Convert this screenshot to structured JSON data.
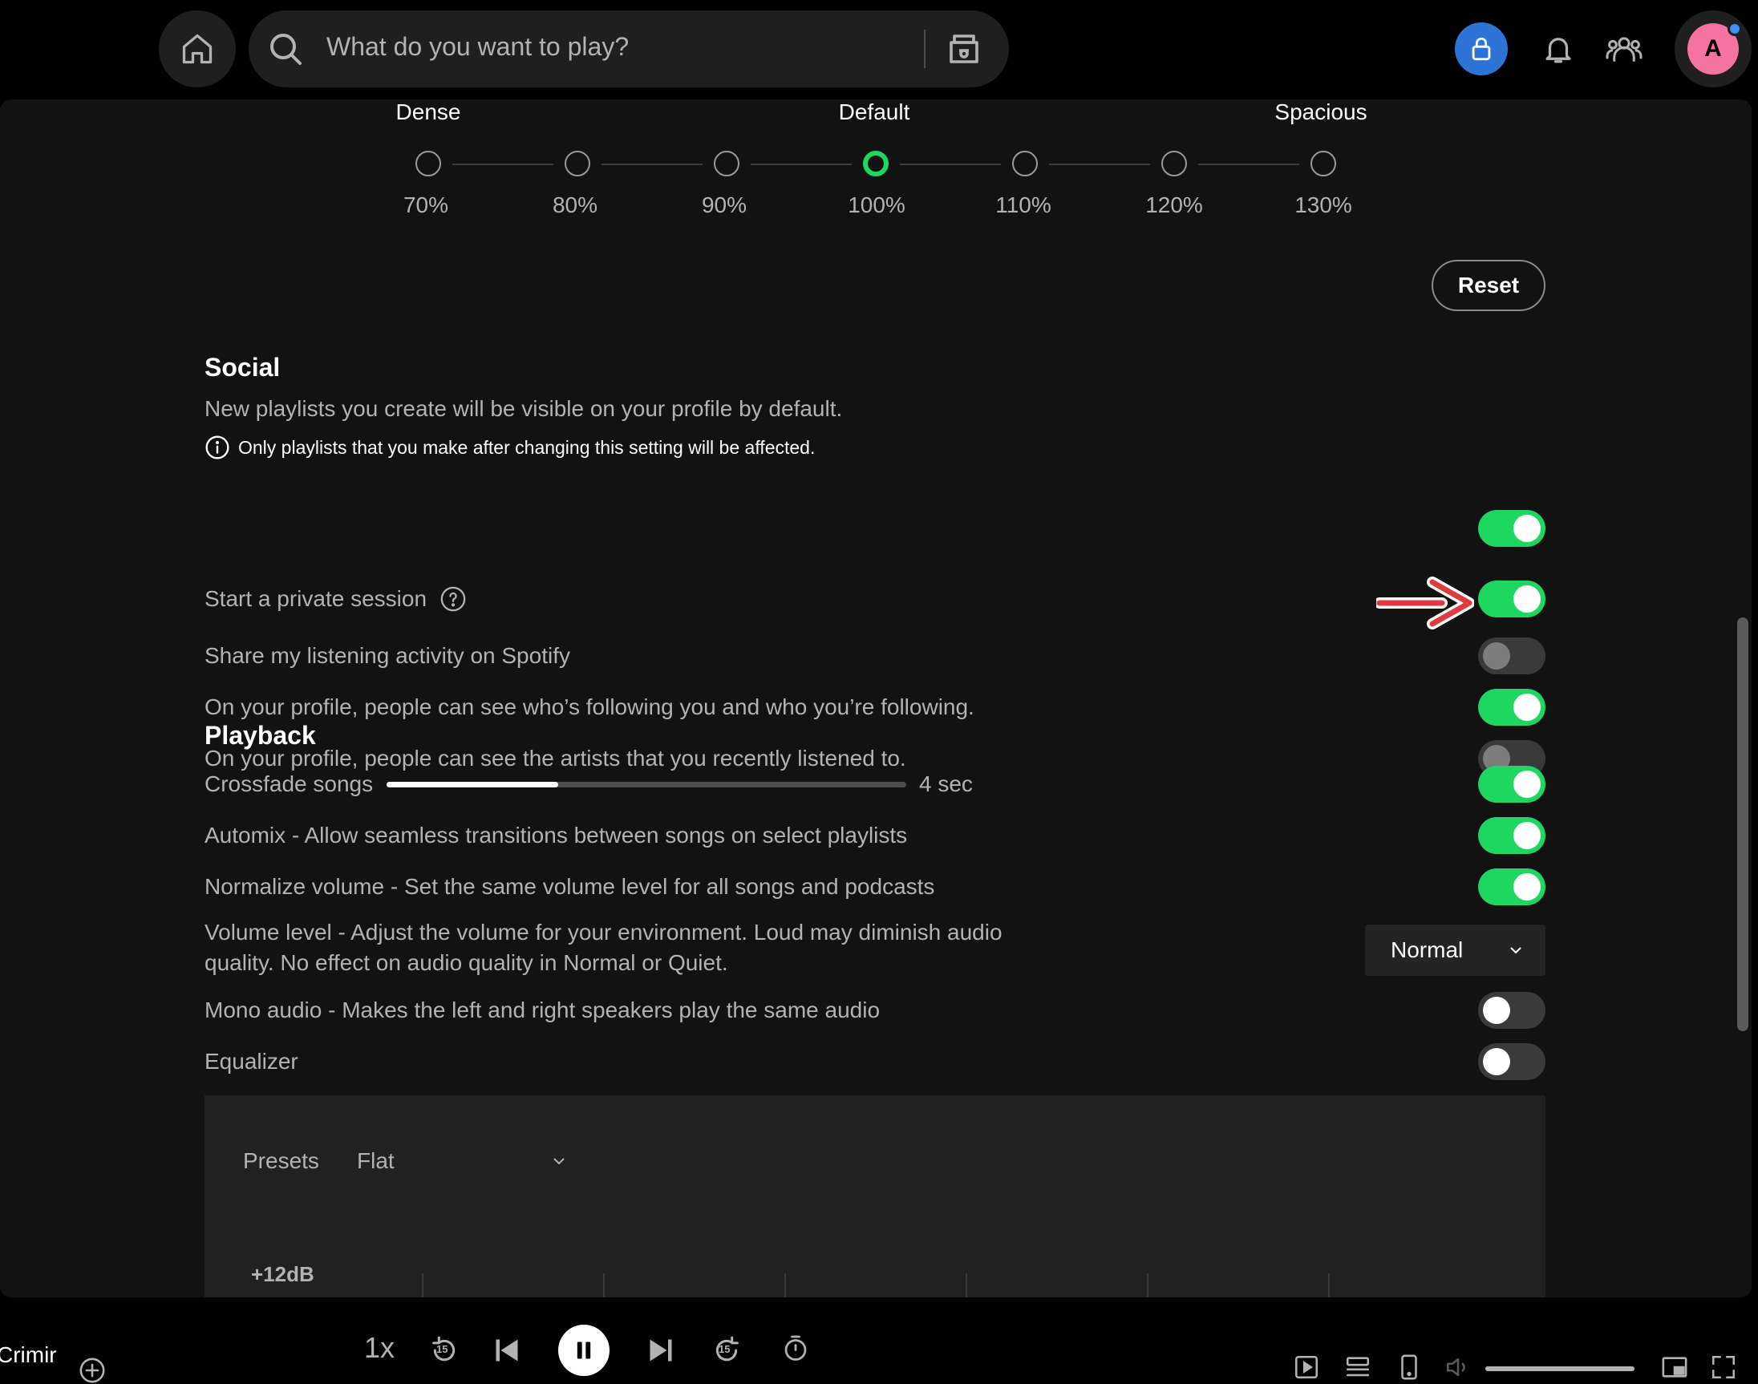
{
  "search": {
    "placeholder": "What do you want to play?"
  },
  "profile": {
    "initial": "A"
  },
  "zoom": {
    "headings": [
      "Dense",
      "Default",
      "Spacious"
    ],
    "levels": [
      "70%",
      "80%",
      "90%",
      "100%",
      "110%",
      "120%",
      "130%"
    ],
    "selected": "100%",
    "reset_label": "Reset"
  },
  "social": {
    "title": "Social",
    "playlist_visibility": {
      "label": "New playlists you create will be visible on your profile by default.",
      "note": "Only playlists that you make after changing this setting will be affected.",
      "on": true
    },
    "private_session": {
      "label": "Start a private session",
      "on": true
    },
    "share_activity": {
      "label": "Share my listening activity on Spotify",
      "on": false
    },
    "show_follows": {
      "label": "On your profile, people can see who’s following you and who you’re following.",
      "on": true
    },
    "recent_artists": {
      "label": "On your profile, people can see the artists that you recently listened to.",
      "on": false
    }
  },
  "playback": {
    "title": "Playback",
    "crossfade": {
      "label": "Crossfade songs",
      "value_text": "4 sec",
      "fraction": 0.33,
      "on": true
    },
    "automix": {
      "label": "Automix - Allow seamless transitions between songs on select playlists",
      "on": true
    },
    "normalize": {
      "label": "Normalize volume - Set the same volume level for all songs and podcasts",
      "on": true
    },
    "volume_level": {
      "label": "Volume level - Adjust the volume for your environment. Loud may diminish audio quality. No effect on audio quality in Normal or Quiet.",
      "value": "Normal"
    },
    "mono": {
      "label": "Mono audio - Makes the left and right speakers play the same audio",
      "on": false
    },
    "equalizer": {
      "label": "Equalizer",
      "on": false
    }
  },
  "equalizer": {
    "presets_label": "Presets",
    "preset_value": "Flat",
    "db_label": "+12dB"
  },
  "player": {
    "now_playing": "Crimir",
    "speed": "1x",
    "skip_back_seconds": "15",
    "skip_forward_seconds": "15"
  },
  "colors": {
    "accent_green": "#1ed760",
    "annotation_arrow": "#e0393e",
    "lock_blue": "#2d74d6",
    "avatar_pink": "#f573a0"
  },
  "icons": [
    "home-icon",
    "search-icon",
    "browse-icon",
    "lock-icon",
    "bell-icon",
    "friends-icon",
    "info-icon",
    "help-icon",
    "chevron-down-icon",
    "add-icon",
    "skip-back-15-icon",
    "previous-icon",
    "pause-icon",
    "next-icon",
    "skip-forward-15-icon",
    "sleep-timer-icon",
    "now-playing-view-icon",
    "queue-icon",
    "connect-device-icon",
    "volume-icon",
    "miniplayer-icon",
    "fullscreen-icon",
    "annotation-arrow"
  ]
}
